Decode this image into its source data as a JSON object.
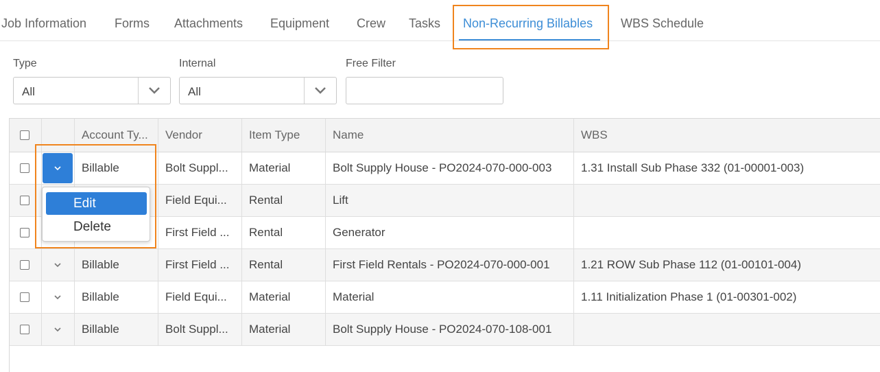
{
  "tabs": [
    {
      "label": "Job Information"
    },
    {
      "label": "Forms"
    },
    {
      "label": "Attachments"
    },
    {
      "label": "Equipment"
    },
    {
      "label": "Crew"
    },
    {
      "label": "Tasks"
    },
    {
      "label": "Non-Recurring Billables",
      "active": true
    },
    {
      "label": "WBS Schedule"
    }
  ],
  "filters": {
    "type": {
      "label": "Type",
      "value": "All"
    },
    "internal": {
      "label": "Internal",
      "value": "All"
    },
    "free_filter": {
      "label": "Free Filter",
      "value": "",
      "placeholder": ""
    }
  },
  "grid": {
    "columns": [
      "",
      "",
      "Account Ty...",
      "Vendor",
      "Item Type",
      "Name",
      "WBS"
    ],
    "rows": [
      {
        "account_type": "Billable",
        "vendor": "Bolt Suppl...",
        "item_type": "Material",
        "name": "Bolt Supply House - PO2024-070-000-003",
        "wbs": "1.31 Install Sub Phase 332 (01-00001-003)"
      },
      {
        "account_type": "",
        "vendor": "Field Equi...",
        "item_type": "Rental",
        "name": "Lift",
        "wbs": ""
      },
      {
        "account_type": "",
        "vendor": "First Field ...",
        "item_type": "Rental",
        "name": "Generator",
        "wbs": ""
      },
      {
        "account_type": "Billable",
        "vendor": "First Field ...",
        "item_type": "Rental",
        "name": "First Field Rentals - PO2024-070-000-001",
        "wbs": "1.21 ROW Sub Phase 112 (01-00101-004)"
      },
      {
        "account_type": "Billable",
        "vendor": "Field Equi...",
        "item_type": "Material",
        "name": "Material",
        "wbs": "1.11 Initialization Phase 1 (01-00301-002)"
      },
      {
        "account_type": "Billable",
        "vendor": "Bolt Suppl...",
        "item_type": "Material",
        "name": "Bolt Supply House - PO2024-070-108-001",
        "wbs": ""
      }
    ]
  },
  "row_menu": {
    "items": [
      {
        "label": "Edit",
        "selected": true
      },
      {
        "label": "Delete"
      }
    ]
  },
  "colors": {
    "accent": "#3c8dd6",
    "highlight": "#f0841d",
    "button_blue": "#2e7fd8"
  }
}
